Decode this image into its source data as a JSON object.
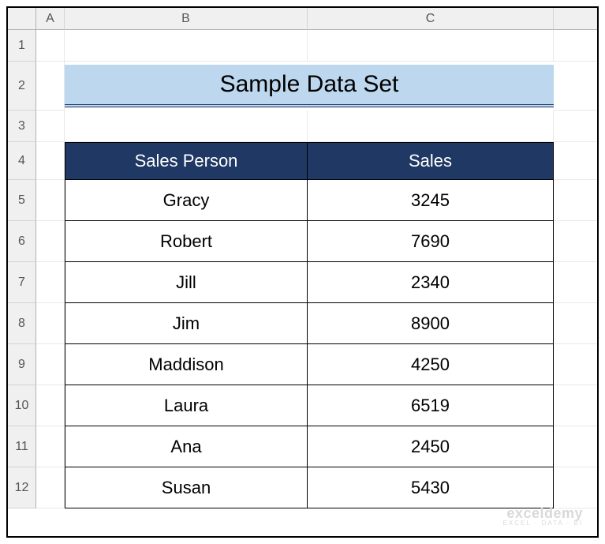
{
  "columns": [
    "A",
    "B",
    "C"
  ],
  "rows": [
    "1",
    "2",
    "3",
    "4",
    "5",
    "6",
    "7",
    "8",
    "9",
    "10",
    "11",
    "12"
  ],
  "title": "Sample Data Set",
  "table": {
    "headers": {
      "person": "Sales Person",
      "sales": "Sales"
    },
    "rows": [
      {
        "person": "Gracy",
        "sales": "3245"
      },
      {
        "person": "Robert",
        "sales": "7690"
      },
      {
        "person": "Jill",
        "sales": "2340"
      },
      {
        "person": "Jim",
        "sales": "8900"
      },
      {
        "person": "Maddison",
        "sales": "4250"
      },
      {
        "person": "Laura",
        "sales": "6519"
      },
      {
        "person": "Ana",
        "sales": "2450"
      },
      {
        "person": "Susan",
        "sales": "5430"
      }
    ]
  },
  "watermark": {
    "top": "exceldemy",
    "bot": "EXCEL · DATA · BI"
  }
}
